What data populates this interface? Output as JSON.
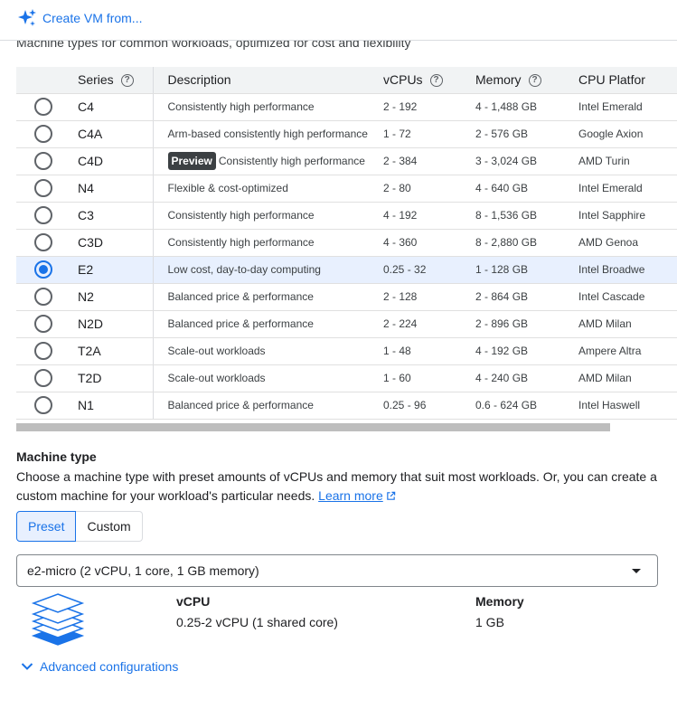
{
  "header": {
    "create_label": "Create VM from..."
  },
  "intro_text": "Machine types for common workloads, optimized for cost and flexibility",
  "table": {
    "columns": [
      "Series",
      "Description",
      "vCPUs",
      "Memory",
      "CPU Platfor"
    ],
    "rows": [
      {
        "series": "C4",
        "desc": "Consistently high performance",
        "badge": "",
        "vcpu": "2 - 192",
        "mem": "4 - 1,488 GB",
        "cpu": "Intel Emerald"
      },
      {
        "series": "C4A",
        "desc": "Arm-based consistently high performance",
        "badge": "",
        "vcpu": "1 - 72",
        "mem": "2 - 576 GB",
        "cpu": "Google Axion"
      },
      {
        "series": "C4D",
        "desc": "Consistently high performance",
        "badge": "Preview",
        "vcpu": "2 - 384",
        "mem": "3 - 3,024 GB",
        "cpu": "AMD Turin"
      },
      {
        "series": "N4",
        "desc": "Flexible & cost-optimized",
        "badge": "",
        "vcpu": "2 - 80",
        "mem": "4 - 640 GB",
        "cpu": "Intel Emerald"
      },
      {
        "series": "C3",
        "desc": "Consistently high performance",
        "badge": "",
        "vcpu": "4 - 192",
        "mem": "8 - 1,536 GB",
        "cpu": "Intel Sapphire"
      },
      {
        "series": "C3D",
        "desc": "Consistently high performance",
        "badge": "",
        "vcpu": "4 - 360",
        "mem": "8 - 2,880 GB",
        "cpu": "AMD Genoa"
      },
      {
        "series": "E2",
        "desc": "Low cost, day-to-day computing",
        "badge": "",
        "vcpu": "0.25 - 32",
        "mem": "1 - 128 GB",
        "cpu": "Intel Broadwe",
        "selected": true
      },
      {
        "series": "N2",
        "desc": "Balanced price & performance",
        "badge": "",
        "vcpu": "2 - 128",
        "mem": "2 - 864 GB",
        "cpu": "Intel Cascade"
      },
      {
        "series": "N2D",
        "desc": "Balanced price & performance",
        "badge": "",
        "vcpu": "2 - 224",
        "mem": "2 - 896 GB",
        "cpu": "AMD Milan"
      },
      {
        "series": "T2A",
        "desc": "Scale-out workloads",
        "badge": "",
        "vcpu": "1 - 48",
        "mem": "4 - 192 GB",
        "cpu": "Ampere Altra"
      },
      {
        "series": "T2D",
        "desc": "Scale-out workloads",
        "badge": "",
        "vcpu": "1 - 60",
        "mem": "4 - 240 GB",
        "cpu": "AMD Milan"
      },
      {
        "series": "N1",
        "desc": "Balanced price & performance",
        "badge": "",
        "vcpu": "0.25 - 96",
        "mem": "0.6 - 624 GB",
        "cpu": "Intel Haswell"
      }
    ]
  },
  "machine_type": {
    "title": "Machine type",
    "description": "Choose a machine type with preset amounts of vCPUs and memory that suit most workloads. Or, you can create a custom machine for your workload's particular needs.",
    "learn_more": "Learn more",
    "tabs": {
      "preset": "Preset",
      "custom": "Custom"
    },
    "selected_value": "e2-micro (2 vCPU, 1 core, 1 GB memory)",
    "vcpu_label": "vCPU",
    "vcpu_value": "0.25-2 vCPU (1 shared core)",
    "memory_label": "Memory",
    "memory_value": "1 GB"
  },
  "advanced_label": "Advanced configurations",
  "colors": {
    "accent": "#1a73e8",
    "selected_row": "#e8f0fe",
    "header_bg": "#f1f3f4",
    "badge": "#3c4043"
  },
  "icons": [
    "sparkle-icon",
    "help-icon",
    "external-link-icon",
    "chevron-down-icon",
    "layers-icon"
  ]
}
